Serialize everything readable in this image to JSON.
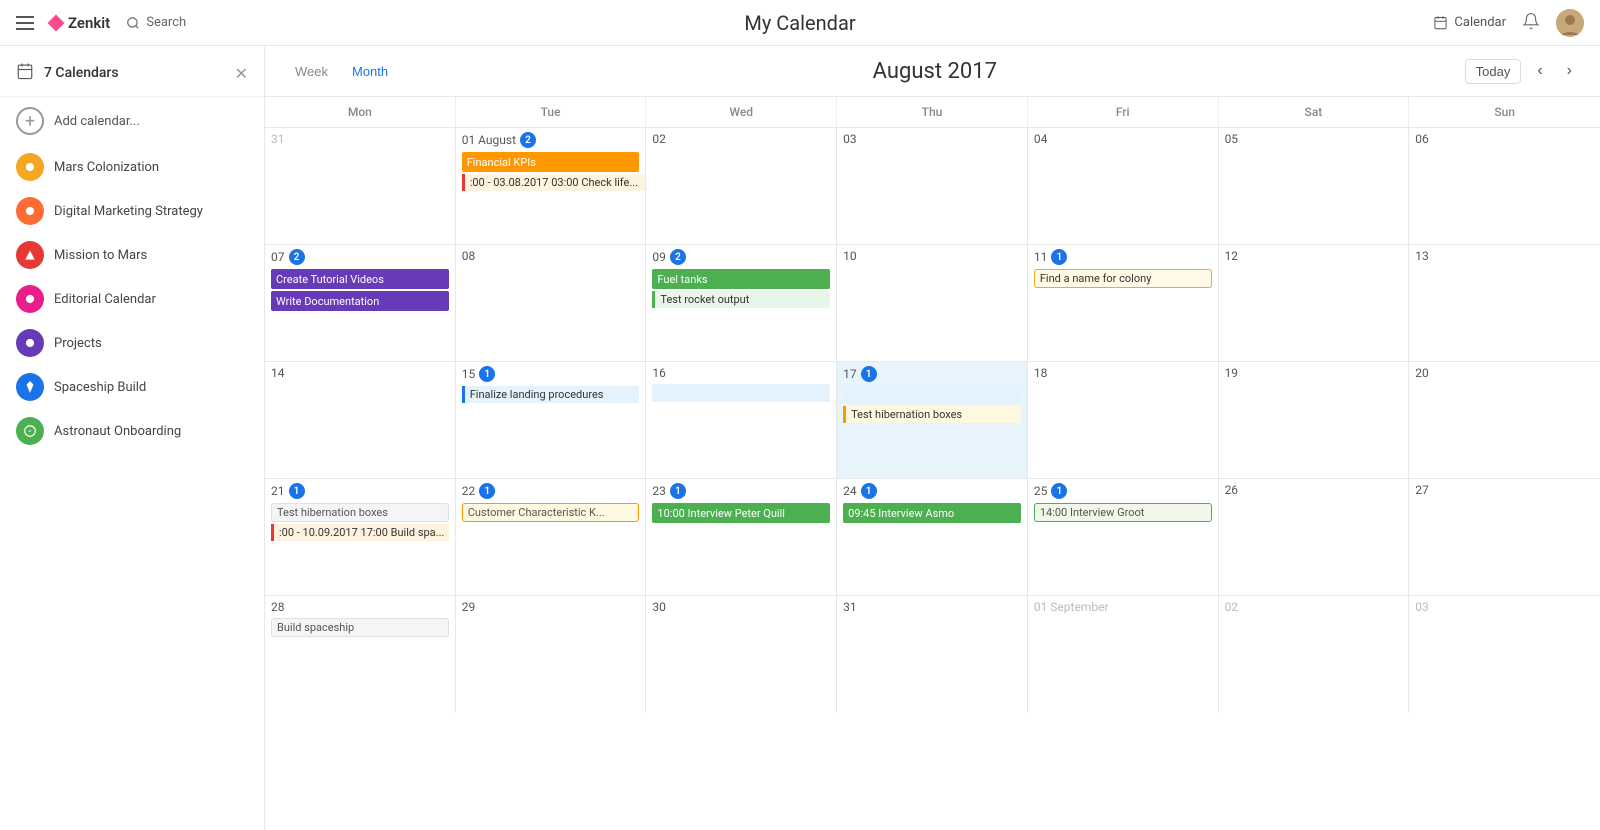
{
  "app": {
    "name": "Zenkit",
    "title": "My Calendar"
  },
  "navbar": {
    "search_label": "Search",
    "calendar_label": "Calendar",
    "title": "My Calendar"
  },
  "sidebar": {
    "title": "7 Calendars",
    "add_label": "Add calendar...",
    "calendars": [
      {
        "id": "mars-colonization",
        "label": "Mars Colonization",
        "color": "#f5a623",
        "icon": "⬤"
      },
      {
        "id": "digital-marketing",
        "label": "Digital Marketing Strategy",
        "color": "#ff6b35",
        "icon": "⬤"
      },
      {
        "id": "mission-to-mars",
        "label": "Mission to Mars",
        "color": "#e53935",
        "icon": "⬤"
      },
      {
        "id": "editorial-calendar",
        "label": "Editorial Calendar",
        "color": "#e91e8c",
        "icon": "⬤"
      },
      {
        "id": "projects",
        "label": "Projects",
        "color": "#673ab7",
        "icon": "⬤"
      },
      {
        "id": "spaceship-build",
        "label": "Spaceship Build",
        "color": "#1a73e8",
        "icon": "⬤"
      },
      {
        "id": "astronaut-onboarding",
        "label": "Astronaut Onboarding",
        "color": "#4caf50",
        "icon": "⬤"
      }
    ]
  },
  "calendar": {
    "month_title": "August 2017",
    "view_week": "Week",
    "view_month": "Month",
    "today_label": "Today",
    "days": [
      "Mon",
      "Tue",
      "Wed",
      "Thu",
      "Fri",
      "Sat",
      "Sun"
    ],
    "weeks": [
      {
        "cells": [
          {
            "num": "31",
            "other": true,
            "events": []
          },
          {
            "num": "01 August",
            "badge": "2",
            "events": [
              {
                "type": "bar",
                "color": "#ff9800",
                "text": "Financial KPIs"
              },
              {
                "type": "span-start",
                "color": "#e53935",
                "text": ":00 - 03.08.2017 03:00 Check life..."
              }
            ]
          },
          {
            "num": "02",
            "events": []
          },
          {
            "num": "03",
            "events": []
          },
          {
            "num": "04",
            "events": []
          },
          {
            "num": "05",
            "events": []
          },
          {
            "num": "06",
            "events": []
          }
        ]
      },
      {
        "cells": [
          {
            "num": "07",
            "badge": "2",
            "events": [
              {
                "type": "bar",
                "color": "#673ab7",
                "text": "Create Tutorial Videos"
              },
              {
                "type": "bar",
                "color": "#673ab7",
                "text": "Write Documentation"
              }
            ]
          },
          {
            "num": "08",
            "events": []
          },
          {
            "num": "09",
            "badge": "2",
            "events": [
              {
                "type": "bar",
                "color": "#4caf50",
                "text": "Fuel tanks"
              },
              {
                "type": "bar",
                "color": "#4caf50",
                "text": "Test rocket output"
              }
            ]
          },
          {
            "num": "10",
            "events": []
          },
          {
            "num": "11",
            "badge": "1",
            "events": [
              {
                "type": "outline",
                "color": "#f5a623",
                "text": "Find a name for colony"
              }
            ]
          },
          {
            "num": "12",
            "events": []
          },
          {
            "num": "13",
            "events": []
          }
        ]
      },
      {
        "cells": [
          {
            "num": "14",
            "events": []
          },
          {
            "num": "15",
            "badge": "1",
            "events": [
              {
                "type": "span-start",
                "color": "#1a73e8",
                "text": "Finalize landing procedures"
              }
            ]
          },
          {
            "num": "16",
            "events": []
          },
          {
            "num": "17",
            "badge": "1",
            "today": true,
            "events": [
              {
                "type": "outline",
                "color": "#ff9800",
                "text": "Test hibernation boxes"
              }
            ]
          },
          {
            "num": "18",
            "events": []
          },
          {
            "num": "19",
            "events": []
          },
          {
            "num": "20",
            "events": []
          }
        ]
      },
      {
        "cells": [
          {
            "num": "21",
            "badge": "1",
            "events": [
              {
                "type": "outline",
                "color": "#ccc",
                "text": "Test hibernation boxes"
              },
              {
                "type": "span-start",
                "color": "#e53935",
                "text": ":00 - 10.09.2017 17:00 Build spa..."
              }
            ]
          },
          {
            "num": "22",
            "badge": "1",
            "events": [
              {
                "type": "outline",
                "color": "#ff9800",
                "text": "Customer Characteristic K..."
              }
            ]
          },
          {
            "num": "23",
            "badge": "1",
            "events": [
              {
                "type": "bar",
                "color": "#4caf50",
                "text": "10:00 Interview Peter Quill"
              }
            ]
          },
          {
            "num": "24",
            "badge": "1",
            "events": [
              {
                "type": "bar",
                "color": "#4caf50",
                "text": "09:45 Interview Asmo"
              }
            ]
          },
          {
            "num": "25",
            "badge": "1",
            "events": [
              {
                "type": "outline",
                "color": "#4caf50",
                "text": "14:00 Interview Groot"
              }
            ]
          },
          {
            "num": "26",
            "events": []
          },
          {
            "num": "27",
            "events": []
          }
        ]
      },
      {
        "cells": [
          {
            "num": "28",
            "events": [
              {
                "type": "outline",
                "color": "#ccc",
                "text": "Build spaceship"
              }
            ]
          },
          {
            "num": "29",
            "events": []
          },
          {
            "num": "30",
            "events": []
          },
          {
            "num": "31",
            "events": []
          },
          {
            "num": "01 September",
            "other": true,
            "events": []
          },
          {
            "num": "02",
            "other": true,
            "events": []
          },
          {
            "num": "03",
            "other": true,
            "events": []
          }
        ]
      }
    ]
  }
}
